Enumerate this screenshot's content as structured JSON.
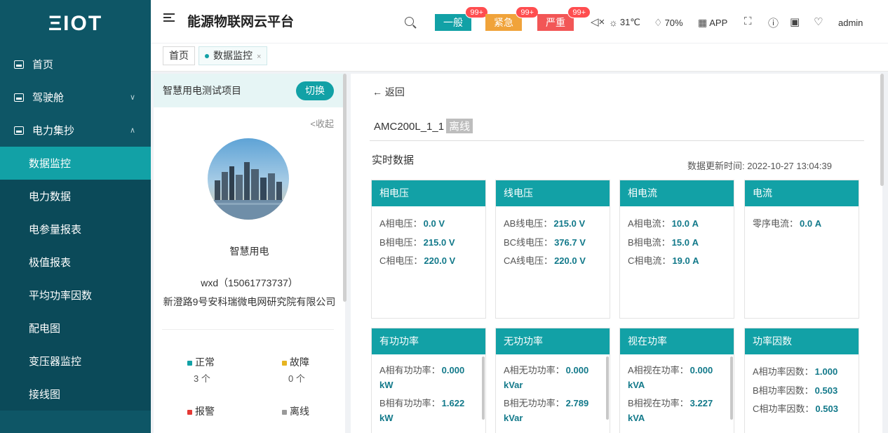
{
  "app": {
    "logo": "ΞIOT",
    "title": "能源物联网云平台"
  },
  "sidebar": {
    "items": [
      {
        "label": "首页",
        "icon": "monitor-icon"
      },
      {
        "label": "驾驶舱",
        "icon": "dashboard-icon",
        "chevron": "∨"
      },
      {
        "label": "电力集抄",
        "icon": "meter-icon",
        "chevron": "∧"
      }
    ],
    "subitems": [
      "数据监控",
      "电力数据",
      "电参量报表",
      "极值报表",
      "平均功率因数",
      "配电图",
      "变压器监控",
      "接线图"
    ],
    "active": "数据监控"
  },
  "header": {
    "alarms": [
      {
        "label": "一般",
        "count": "99+",
        "color": "#12a1a6"
      },
      {
        "label": "紧急",
        "count": "99+",
        "color": "#f0a33a"
      },
      {
        "label": "严重",
        "count": "99+",
        "color": "#f25656"
      }
    ],
    "temperature": "31℃",
    "humidity": "70%",
    "app_label": "APP",
    "user": "admin"
  },
  "tabs": [
    {
      "label": "首页",
      "active": false
    },
    {
      "label": "数据监控",
      "active": true,
      "close": "×"
    }
  ],
  "project": {
    "name": "智慧用电测试项目",
    "switch_label": "切换",
    "collapse_label": "<收起",
    "display_name": "智慧用电",
    "user": "wxd（15061773737）",
    "address": "新澄路9号安科瑞微电网研究院有限公司",
    "stats": [
      {
        "label": "正常",
        "count": "3 个",
        "color": "#12a1a6"
      },
      {
        "label": "故障",
        "count": "0 个",
        "color": "#e6b422"
      },
      {
        "label": "报警",
        "count": "",
        "color": "#e53935"
      },
      {
        "label": "离线",
        "count": "",
        "color": "#999999"
      }
    ]
  },
  "device": {
    "back_label": "← 返回",
    "name": "AMC200L_1_1",
    "status": "离线",
    "realtime_title": "实时数据",
    "update_time": "数据更新时间: 2022-10-27 13:04:39",
    "cards": [
      {
        "title": "相电压",
        "rows": [
          {
            "label": "A相电压：",
            "value": "0.0 V"
          },
          {
            "label": "B相电压：",
            "value": "215.0 V"
          },
          {
            "label": "C相电压：",
            "value": "220.0 V"
          }
        ]
      },
      {
        "title": "线电压",
        "rows": [
          {
            "label": "AB线电压：",
            "value": "215.0 V"
          },
          {
            "label": "BC线电压：",
            "value": "376.7 V"
          },
          {
            "label": "CA线电压：",
            "value": "220.0 V"
          }
        ]
      },
      {
        "title": "相电流",
        "rows": [
          {
            "label": "A相电流：",
            "value": "10.0 A"
          },
          {
            "label": "B相电流：",
            "value": "15.0 A"
          },
          {
            "label": "C相电流：",
            "value": "19.0 A"
          }
        ]
      },
      {
        "title": "电流",
        "rows": [
          {
            "label": "零序电流：",
            "value": "0.0 A"
          }
        ]
      },
      {
        "title": "有功功率",
        "rows": [
          {
            "label": "A相有功功率：",
            "value": "0.000 kW"
          },
          {
            "label": "B相有功功率：",
            "value": "1.622 kW"
          }
        ]
      },
      {
        "title": "无功功率",
        "rows": [
          {
            "label": "A相无功功率：",
            "value": "0.000 kVar"
          },
          {
            "label": "B相无功功率：",
            "value": "2.789 kVar"
          }
        ]
      },
      {
        "title": "视在功率",
        "rows": [
          {
            "label": "A相视在功率：",
            "value": "0.000 kVA"
          },
          {
            "label": "B相视在功率：",
            "value": "3.227 kVA"
          }
        ]
      },
      {
        "title": "功率因数",
        "rows": [
          {
            "label": "A相功率因数：",
            "value": "1.000"
          },
          {
            "label": "B相功率因数：",
            "value": "0.503"
          },
          {
            "label": "C相功率因数：",
            "value": "0.503"
          }
        ]
      }
    ]
  }
}
